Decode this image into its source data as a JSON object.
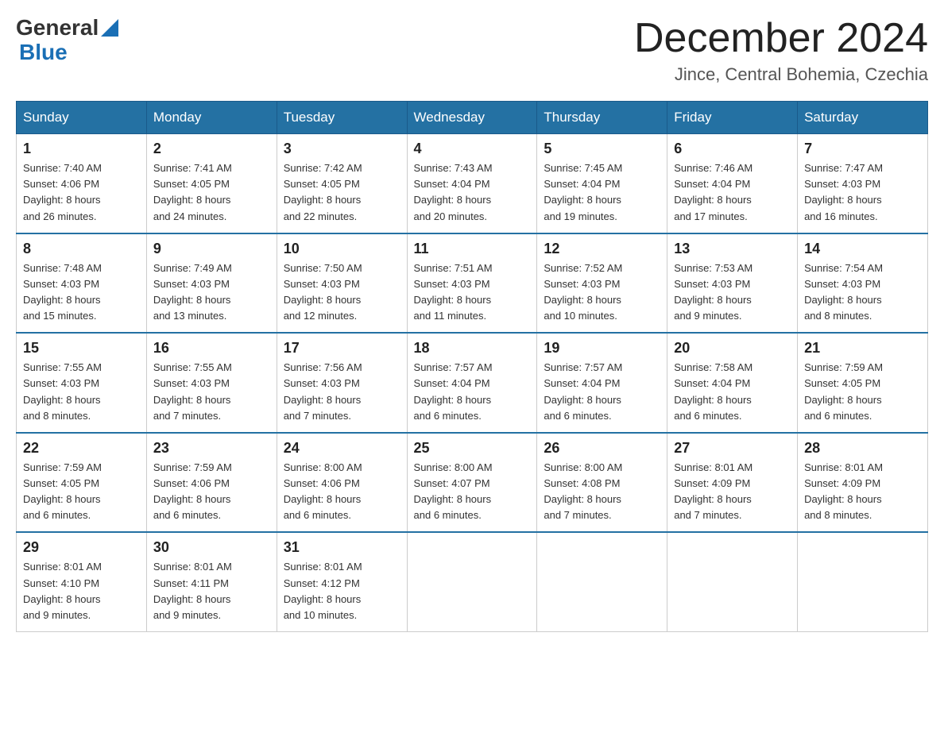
{
  "logo": {
    "general": "General",
    "blue": "Blue"
  },
  "title": "December 2024",
  "location": "Jince, Central Bohemia, Czechia",
  "days_of_week": [
    "Sunday",
    "Monday",
    "Tuesday",
    "Wednesday",
    "Thursday",
    "Friday",
    "Saturday"
  ],
  "weeks": [
    [
      {
        "day": "1",
        "sunrise": "7:40 AM",
        "sunset": "4:06 PM",
        "daylight": "8 hours and 26 minutes."
      },
      {
        "day": "2",
        "sunrise": "7:41 AM",
        "sunset": "4:05 PM",
        "daylight": "8 hours and 24 minutes."
      },
      {
        "day": "3",
        "sunrise": "7:42 AM",
        "sunset": "4:05 PM",
        "daylight": "8 hours and 22 minutes."
      },
      {
        "day": "4",
        "sunrise": "7:43 AM",
        "sunset": "4:04 PM",
        "daylight": "8 hours and 20 minutes."
      },
      {
        "day": "5",
        "sunrise": "7:45 AM",
        "sunset": "4:04 PM",
        "daylight": "8 hours and 19 minutes."
      },
      {
        "day": "6",
        "sunrise": "7:46 AM",
        "sunset": "4:04 PM",
        "daylight": "8 hours and 17 minutes."
      },
      {
        "day": "7",
        "sunrise": "7:47 AM",
        "sunset": "4:03 PM",
        "daylight": "8 hours and 16 minutes."
      }
    ],
    [
      {
        "day": "8",
        "sunrise": "7:48 AM",
        "sunset": "4:03 PM",
        "daylight": "8 hours and 15 minutes."
      },
      {
        "day": "9",
        "sunrise": "7:49 AM",
        "sunset": "4:03 PM",
        "daylight": "8 hours and 13 minutes."
      },
      {
        "day": "10",
        "sunrise": "7:50 AM",
        "sunset": "4:03 PM",
        "daylight": "8 hours and 12 minutes."
      },
      {
        "day": "11",
        "sunrise": "7:51 AM",
        "sunset": "4:03 PM",
        "daylight": "8 hours and 11 minutes."
      },
      {
        "day": "12",
        "sunrise": "7:52 AM",
        "sunset": "4:03 PM",
        "daylight": "8 hours and 10 minutes."
      },
      {
        "day": "13",
        "sunrise": "7:53 AM",
        "sunset": "4:03 PM",
        "daylight": "8 hours and 9 minutes."
      },
      {
        "day": "14",
        "sunrise": "7:54 AM",
        "sunset": "4:03 PM",
        "daylight": "8 hours and 8 minutes."
      }
    ],
    [
      {
        "day": "15",
        "sunrise": "7:55 AM",
        "sunset": "4:03 PM",
        "daylight": "8 hours and 8 minutes."
      },
      {
        "day": "16",
        "sunrise": "7:55 AM",
        "sunset": "4:03 PM",
        "daylight": "8 hours and 7 minutes."
      },
      {
        "day": "17",
        "sunrise": "7:56 AM",
        "sunset": "4:03 PM",
        "daylight": "8 hours and 7 minutes."
      },
      {
        "day": "18",
        "sunrise": "7:57 AM",
        "sunset": "4:04 PM",
        "daylight": "8 hours and 6 minutes."
      },
      {
        "day": "19",
        "sunrise": "7:57 AM",
        "sunset": "4:04 PM",
        "daylight": "8 hours and 6 minutes."
      },
      {
        "day": "20",
        "sunrise": "7:58 AM",
        "sunset": "4:04 PM",
        "daylight": "8 hours and 6 minutes."
      },
      {
        "day": "21",
        "sunrise": "7:59 AM",
        "sunset": "4:05 PM",
        "daylight": "8 hours and 6 minutes."
      }
    ],
    [
      {
        "day": "22",
        "sunrise": "7:59 AM",
        "sunset": "4:05 PM",
        "daylight": "8 hours and 6 minutes."
      },
      {
        "day": "23",
        "sunrise": "7:59 AM",
        "sunset": "4:06 PM",
        "daylight": "8 hours and 6 minutes."
      },
      {
        "day": "24",
        "sunrise": "8:00 AM",
        "sunset": "4:06 PM",
        "daylight": "8 hours and 6 minutes."
      },
      {
        "day": "25",
        "sunrise": "8:00 AM",
        "sunset": "4:07 PM",
        "daylight": "8 hours and 6 minutes."
      },
      {
        "day": "26",
        "sunrise": "8:00 AM",
        "sunset": "4:08 PM",
        "daylight": "8 hours and 7 minutes."
      },
      {
        "day": "27",
        "sunrise": "8:01 AM",
        "sunset": "4:09 PM",
        "daylight": "8 hours and 7 minutes."
      },
      {
        "day": "28",
        "sunrise": "8:01 AM",
        "sunset": "4:09 PM",
        "daylight": "8 hours and 8 minutes."
      }
    ],
    [
      {
        "day": "29",
        "sunrise": "8:01 AM",
        "sunset": "4:10 PM",
        "daylight": "8 hours and 9 minutes."
      },
      {
        "day": "30",
        "sunrise": "8:01 AM",
        "sunset": "4:11 PM",
        "daylight": "8 hours and 9 minutes."
      },
      {
        "day": "31",
        "sunrise": "8:01 AM",
        "sunset": "4:12 PM",
        "daylight": "8 hours and 10 minutes."
      },
      null,
      null,
      null,
      null
    ]
  ],
  "labels": {
    "sunrise": "Sunrise:",
    "sunset": "Sunset:",
    "daylight": "Daylight:"
  }
}
